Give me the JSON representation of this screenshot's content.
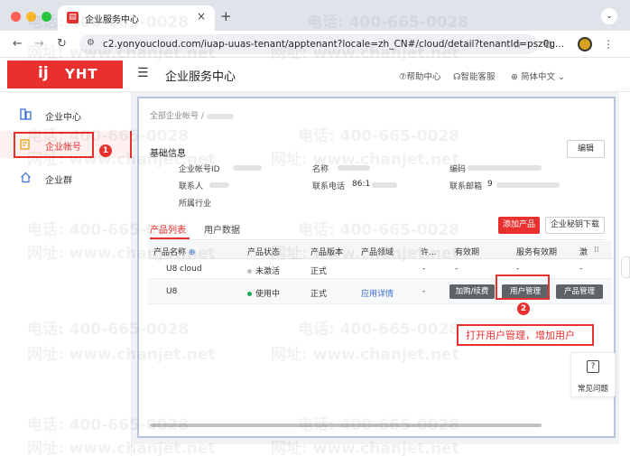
{
  "browser": {
    "tab_title": "企业服务中心",
    "tab_close": "×",
    "new_tab": "+",
    "url": "c2.yonyoucloud.com/iuap-uuas-tenant/apptenant?locale=zh_CN#/cloud/detail?tenantId=psz0g...",
    "tab_menu": "⌄"
  },
  "header": {
    "logo_mark": "ij",
    "logo_text": "YHT",
    "title": "企业服务中心",
    "help": "⑦帮助中心",
    "service": "智能客服",
    "language": "简体中文"
  },
  "sidebar": {
    "items": [
      {
        "label": "企业中心"
      },
      {
        "label": "企业帐号"
      },
      {
        "label": "企业群"
      }
    ],
    "step1": "1"
  },
  "main": {
    "breadcrumb": "全部企业帐号 /",
    "section_title": "基础信息",
    "edit": "编辑",
    "info": {
      "account_id_label": "企业帐号ID",
      "name_label": "名称",
      "code_label": "编码",
      "contact_label": "联系人",
      "phone_label": "联系电话",
      "phone_value": "86:1",
      "email_label": "联系邮箱",
      "email_value": "9",
      "industry_label": "所属行业"
    },
    "tabs": [
      {
        "label": "产品列表"
      },
      {
        "label": "用户数据"
      }
    ],
    "add_product": "添加产品",
    "download": "企业秘钥下载",
    "table": {
      "headers": [
        "产品名称",
        "产品状态",
        "产品版本",
        "产品领域",
        "许...",
        "有效期",
        "服务有效期",
        "激"
      ],
      "rows": [
        {
          "name": "U8 cloud",
          "status": "未激活",
          "version": "正式",
          "domain": "",
          "permit": "-",
          "validity": "-",
          "service_validity": "-",
          "active": "-"
        },
        {
          "name": "U8",
          "status": "使用中",
          "version": "正式",
          "domain": "应用详情",
          "permit": "-"
        }
      ],
      "row_actions": {
        "renew": "加购/续费",
        "user_manage": "用户管理",
        "product_manage": "产品管理"
      }
    },
    "step2": "2",
    "annotation": "打开用户管理，增加用户"
  },
  "float_help": {
    "icon": "?",
    "label": "常见问题"
  },
  "watermark": {
    "phone": "电话: 400-665-0028",
    "site": "网址: www.chanjet.net"
  },
  "colors": {
    "brand_red": "#e8312f",
    "panel_border": "#b7c4dc",
    "link_blue": "#3b6fd6",
    "status_green": "#1aad5a"
  }
}
